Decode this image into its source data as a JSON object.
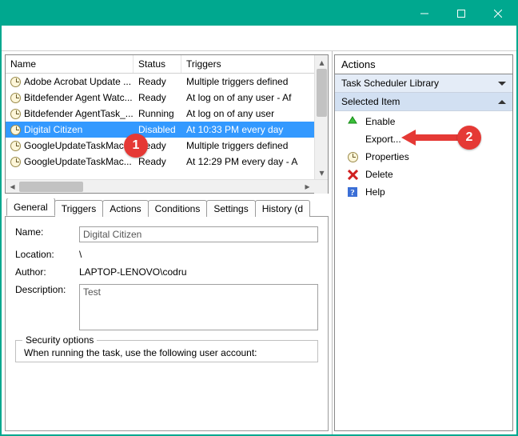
{
  "taskList": {
    "columns": {
      "name": "Name",
      "status": "Status",
      "triggers": "Triggers"
    },
    "rows": [
      {
        "name": "Adobe Acrobat Update ...",
        "status": "Ready",
        "triggers": "Multiple triggers defined"
      },
      {
        "name": "Bitdefender Agent Watc...",
        "status": "Ready",
        "triggers": "At log on of any user - Af"
      },
      {
        "name": "Bitdefender AgentTask_...",
        "status": "Running",
        "triggers": "At log on of any user"
      },
      {
        "name": "Digital Citizen",
        "status": "Disabled",
        "triggers": "At 10:33 PM every day",
        "selected": true
      },
      {
        "name": "GoogleUpdateTaskMac...",
        "status": "Ready",
        "triggers": "Multiple triggers defined"
      },
      {
        "name": "GoogleUpdateTaskMac...",
        "status": "Ready",
        "triggers": "At 12:29 PM every day - A"
      }
    ]
  },
  "tabs": {
    "general": "General",
    "triggers": "Triggers",
    "actions": "Actions",
    "conditions": "Conditions",
    "settings": "Settings",
    "history": "History (d"
  },
  "general": {
    "nameLabel": "Name:",
    "nameValue": "Digital Citizen",
    "locationLabel": "Location:",
    "locationValue": "\\",
    "authorLabel": "Author:",
    "authorValue": "LAPTOP-LENOVO\\codru",
    "descLabel": "Description:",
    "descValue": "Test",
    "secLegend": "Security options",
    "secLine1": "When running the task, use the following user account:"
  },
  "actionsPane": {
    "title": "Actions",
    "group1": "Task Scheduler Library",
    "group2": "Selected Item",
    "items": {
      "enable": "Enable",
      "export": "Export...",
      "properties": "Properties",
      "delete": "Delete",
      "help": "Help"
    }
  },
  "annotations": {
    "badge1": "1",
    "badge2": "2"
  }
}
